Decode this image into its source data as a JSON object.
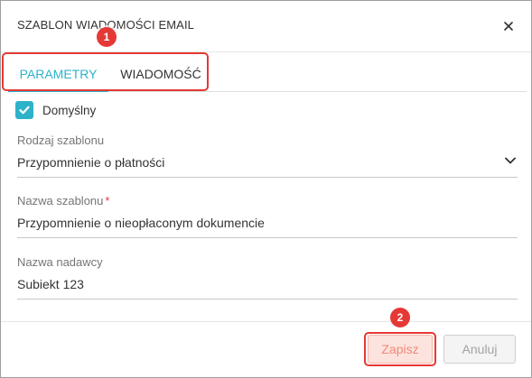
{
  "dialog": {
    "title": "SZABLON WIADOMOŚCI EMAIL",
    "close_icon": "close-icon"
  },
  "tabs": [
    {
      "label": "PARAMETRY",
      "active": true
    },
    {
      "label": "WIADOMOŚĆ",
      "active": false
    }
  ],
  "form": {
    "default_checkbox": {
      "label": "Domyślny",
      "checked": true
    },
    "template_type": {
      "label": "Rodzaj szablonu",
      "value": "Przypomnienie o płatności"
    },
    "template_name": {
      "label": "Nazwa szablonu",
      "required_mark": "*",
      "value": "Przypomnienie o nieopłaconym dokumencie"
    },
    "sender_name": {
      "label": "Nazwa nadawcy",
      "value": "Subiekt 123"
    }
  },
  "buttons": {
    "save": "Zapisz",
    "cancel": "Anuluj"
  },
  "annotations": {
    "badge_1": "1",
    "badge_2": "2"
  },
  "colors": {
    "accent": "#2db3c9",
    "annotation": "#e53935",
    "save_bg": "#fce3de",
    "save_text": "#f08a78"
  }
}
